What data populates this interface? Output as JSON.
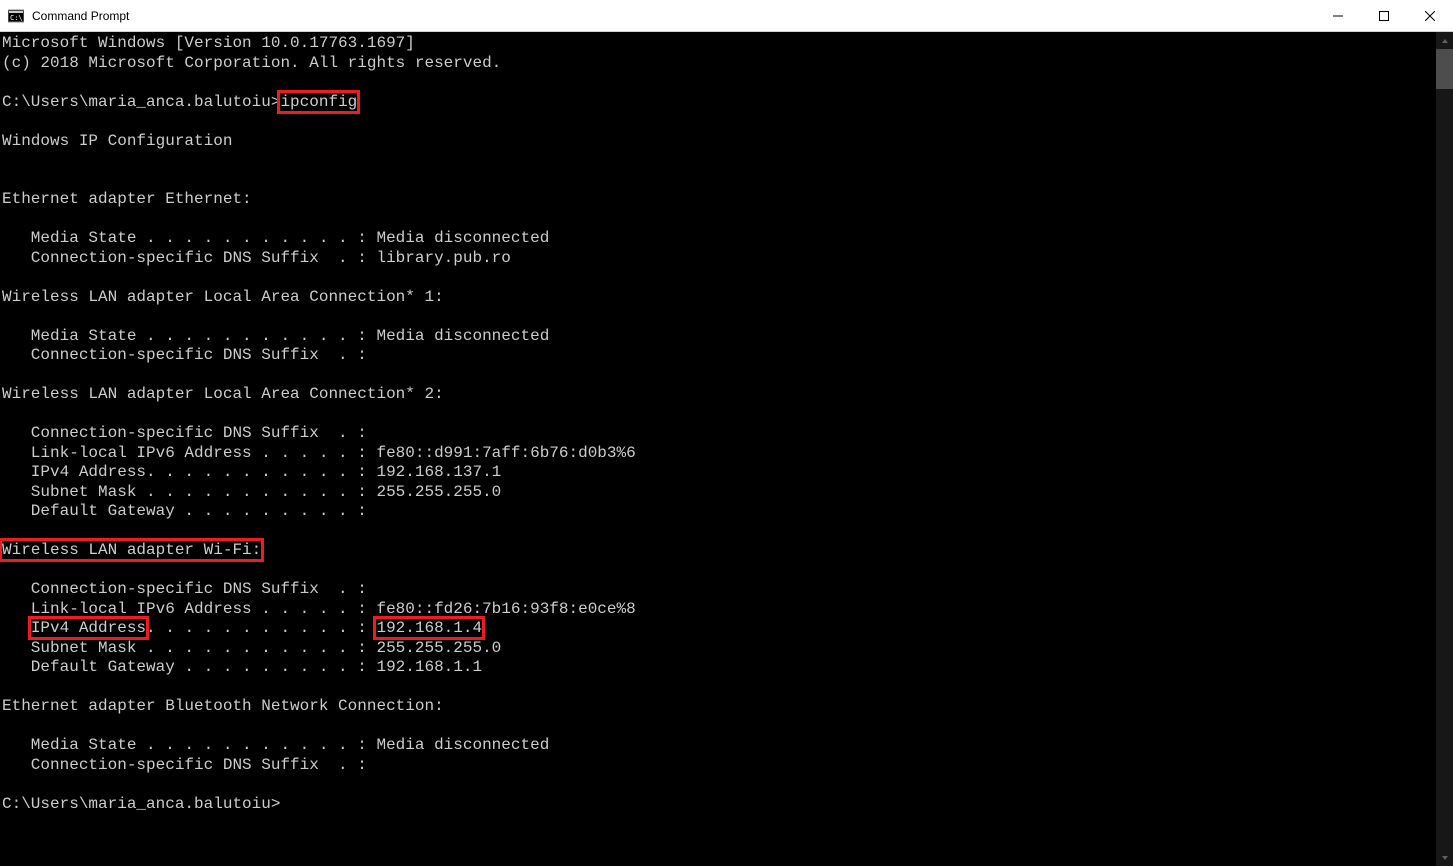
{
  "window": {
    "title": "Command Prompt"
  },
  "prompt": "C:\\Users\\maria_anca.balutoiu>",
  "command": "ipconfig",
  "header": {
    "line1": "Microsoft Windows [Version 10.0.17763.1697]",
    "line2": "(c) 2018 Microsoft Corporation. All rights reserved."
  },
  "ipconfig": {
    "title": "Windows IP Configuration",
    "adapters": [
      {
        "name": "Ethernet adapter Ethernet:",
        "lines": [
          "   Media State . . . . . . . . . . . : Media disconnected",
          "   Connection-specific DNS Suffix  . : library.pub.ro"
        ]
      },
      {
        "name": "Wireless LAN adapter Local Area Connection* 1:",
        "lines": [
          "   Media State . . . . . . . . . . . : Media disconnected",
          "   Connection-specific DNS Suffix  . :"
        ]
      },
      {
        "name": "Wireless LAN adapter Local Area Connection* 2:",
        "lines": [
          "   Connection-specific DNS Suffix  . :",
          "   Link-local IPv6 Address . . . . . : fe80::d991:7aff:6b76:d0b3%6",
          "   IPv4 Address. . . . . . . . . . . : 192.168.137.1",
          "   Subnet Mask . . . . . . . . . . . : 255.255.255.0",
          "   Default Gateway . . . . . . . . . :"
        ]
      },
      {
        "name": "Wireless LAN adapter Wi-Fi:",
        "highlight_name": true,
        "lines_pre": [
          "   Connection-specific DNS Suffix  . :",
          "   Link-local IPv6 Address . . . . . : fe80::fd26:7b16:93f8:e0ce%8"
        ],
        "ipv4_label": "IPv4 Address",
        "ipv4_sep": ". . . . . . . . . . . : ",
        "ipv4_value": "192.168.1.4",
        "lines_post": [
          "   Subnet Mask . . . . . . . . . . . : 255.255.255.0",
          "   Default Gateway . . . . . . . . . : 192.168.1.1"
        ]
      },
      {
        "name": "Ethernet adapter Bluetooth Network Connection:",
        "lines": [
          "   Media State . . . . . . . . . . . : Media disconnected",
          "   Connection-specific DNS Suffix  . :"
        ]
      }
    ]
  }
}
